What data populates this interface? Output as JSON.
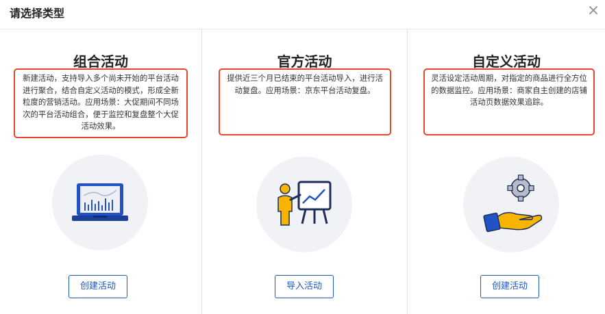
{
  "dialog": {
    "title": "请选择类型"
  },
  "icons": {
    "close": "close-icon",
    "combo": "laptop-chart-icon",
    "official": "presentation-board-icon",
    "custom": "gear-hand-icon"
  },
  "colors": {
    "accent": "#1c57c4",
    "highlight_border": "#e8462a",
    "icon_yellow": "#f7b500",
    "icon_blue": "#2352c7"
  },
  "columns": [
    {
      "title": "组合活动",
      "description": "新建活动，支持导入多个尚未开始的平台活动进行聚合，结合自定义活动的模式，形成全新粒度的营销活动。应用场景：大促期间不同场次的平台活动组合，便于监控和复盘整个大促活动效果。",
      "button": "创建活动"
    },
    {
      "title": "官方活动",
      "description": "提供近三个月已结束的平台活动导入，进行活动复盘。应用场景：京东平台活动复盘。",
      "button": "导入活动"
    },
    {
      "title": "自定义活动",
      "description": "灵活设定活动周期，对指定的商品进行全方位的数据监控。应用场景：商家自主创建的店铺活动页数据效果追踪。",
      "button": "创建活动"
    }
  ]
}
